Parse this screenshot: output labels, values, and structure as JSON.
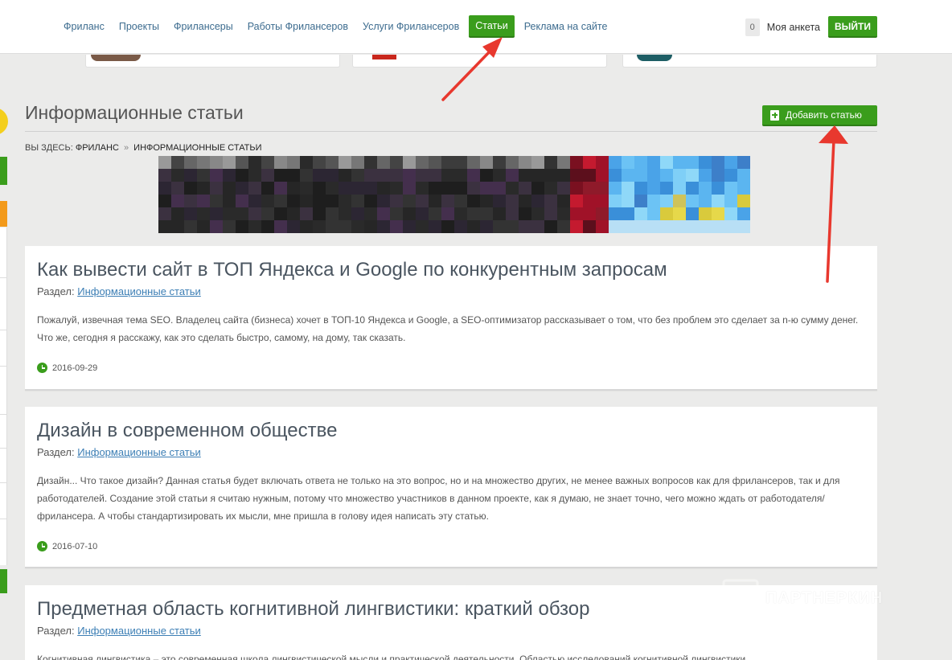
{
  "nav": {
    "items": [
      {
        "label": "Фриланс",
        "active": false
      },
      {
        "label": "Проекты",
        "active": false
      },
      {
        "label": "Фрилансеры",
        "active": false
      },
      {
        "label": "Работы Фрилансеров",
        "active": false
      },
      {
        "label": "Услуги Фрилансеров",
        "active": false
      },
      {
        "label": "Статьи",
        "active": true
      },
      {
        "label": "Реклама на сайте",
        "active": false
      }
    ],
    "counter": "0",
    "my_profile": "Моя анкета",
    "logout": "ВЫЙТИ"
  },
  "page": {
    "title": "Информационные статьи",
    "add_button": "Добавить статью",
    "breadcrumb": {
      "prefix": "Вы здесь:",
      "home": "Фриланс",
      "separator": "»",
      "current": "Информационные статьи"
    }
  },
  "articles": [
    {
      "title": "Как вывести сайт в ТОП Яндекса и Google по конкурентным запросам",
      "section_label": "Раздел:",
      "section": "Информационные статьи",
      "excerpt": "Пожалуй, извечная тема SEO. Владелец сайта (бизнеса) хочет в ТОП-10 Яндекса и Google, а SEO-оптимизатор рассказывает о том, что без проблем это сделает за n-ю сумму денег. Что же, сегодня я расскажу, как это сделать быстро, самому, на дому, так сказать.",
      "date": "2016-09-29"
    },
    {
      "title": "Дизайн в современном обществе",
      "section_label": "Раздел:",
      "section": "Информационные статьи",
      "excerpt": "Дизайн... Что такое дизайн? Данная статья будет включать ответа не только на это вопрос, но и на множество других, не менее важных вопросов как для фрилансеров, так и для работодателей. Создание этой статьи я считаю нужным, потому что множество участников в данном проекте, как я думаю, не знает точно, чего можно ждать от работодателя/фрилансера. А чтобы стандартизировать их мысли, мне пришла в голову идея написать эту статью.",
      "date": "2016-07-10"
    },
    {
      "title": "Предметная область когнитивной лингвистики: краткий обзор",
      "section_label": "Раздел:",
      "section": "Информационные статьи",
      "excerpt": "Когнитивная лингвистика – это современная школа лингвистической мысли и практической деятельности. Областью исследований когнитивной лингвистики",
      "date": ""
    }
  ],
  "watermark": "ПАРТНЕРКИН",
  "colors": {
    "accent_green": "#3a9d1c",
    "link_blue": "#3d7fb5",
    "arrow_red": "#e8382e",
    "page_bg": "#ebebea"
  }
}
